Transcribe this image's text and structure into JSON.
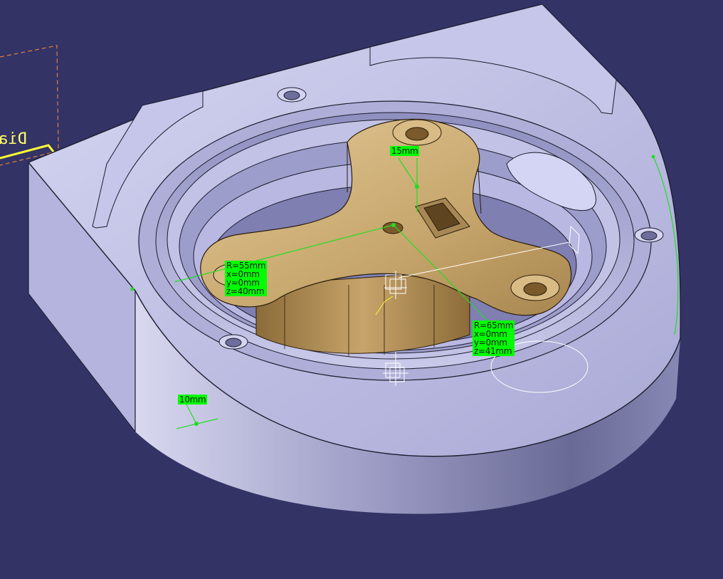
{
  "viewport": {
    "background": "#333366",
    "part_color": "#b9b9e0",
    "insert_color": "#c4a56e",
    "annotation_color": "#00ff00"
  },
  "sketch": {
    "label": "Dia",
    "color": "#ffff66",
    "frame_color": "#e08040"
  },
  "annotations": {
    "thickness_15": "15mm",
    "thickness_10": "10mm",
    "circle_55": {
      "r": "R=55mm",
      "x": "x=0mm",
      "y": "y=0mm",
      "z": "z=40mm"
    },
    "circle_65": {
      "r": "R=65mm",
      "x": "x=0mm",
      "y": "y=0mm",
      "z": "z=41mm"
    }
  },
  "icons": [
    "axis-system-icon",
    "compass-axis-icon",
    "sketch-plane-icon"
  ]
}
